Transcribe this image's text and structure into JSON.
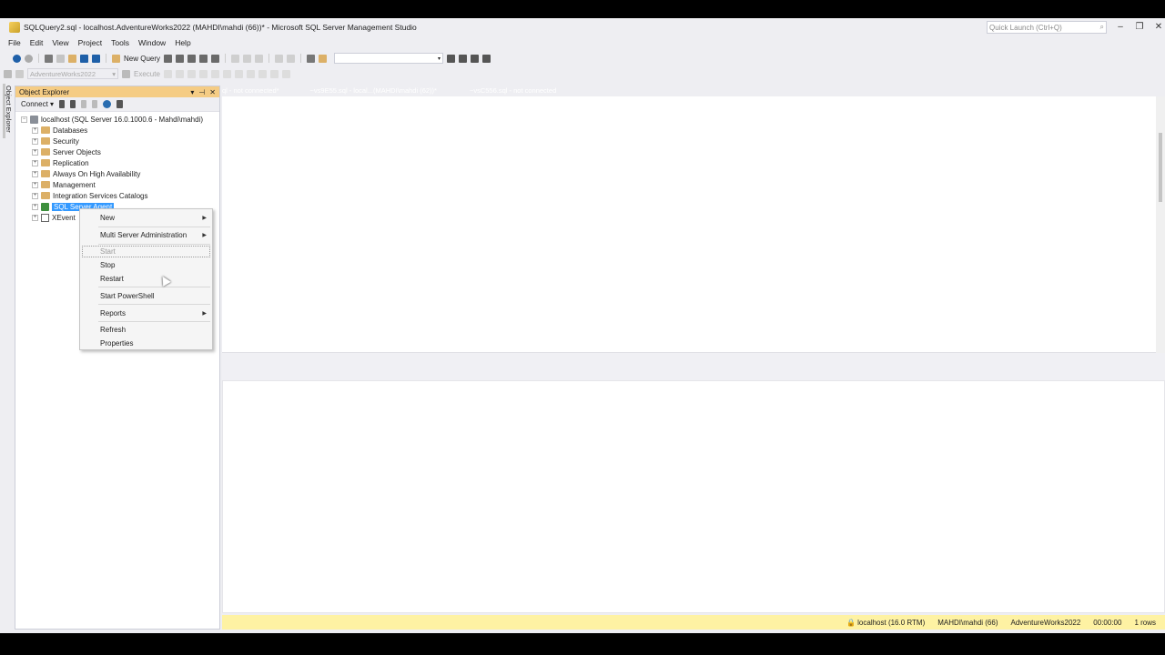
{
  "window": {
    "title": "SQLQuery2.sql - localhost.AdventureWorks2022 (MAHDI\\mahdi (66))* - Microsoft SQL Server Management Studio",
    "quick_launch_placeholder": "Quick Launch (Ctrl+Q)"
  },
  "menu": [
    "File",
    "Edit",
    "View",
    "Project",
    "Tools",
    "Window",
    "Help"
  ],
  "toolbar": {
    "new_query": "New Query",
    "database": "AdventureWorks2022",
    "execute": "Execute"
  },
  "sidebar_tab": "Object Explorer",
  "object_explorer": {
    "title": "Object Explorer",
    "connect": "Connect",
    "server": "localhost (SQL Server 16.0.1000.6 - Mahdi\\mahdi)",
    "nodes": [
      "Databases",
      "Security",
      "Server Objects",
      "Replication",
      "Always On High Availability",
      "Management",
      "Integration Services Catalogs",
      "SQL Server Agent",
      "XEvent"
    ]
  },
  "tabs": [
    "ql - not connected*",
    "~vs9E55.sql - local...(MAHDI\\mahdi (62))*",
    "~vsC556.sql - not connected"
  ],
  "context_menu": {
    "items": [
      "New",
      "Multi Server Administration",
      "Start",
      "Stop",
      "Restart",
      "Start PowerShell",
      "Reports",
      "Refresh",
      "Properties"
    ]
  },
  "status": {
    "server": "localhost (16.0 RTM)",
    "user": "MAHDI\\mahdi (66)",
    "database": "AdventureWorks2022",
    "time": "00:00:00",
    "rows": "1 rows"
  },
  "colors": {
    "accent": "#007acc",
    "oe_header": "#f5cc84",
    "status_bar": "#fef2a3",
    "selection": "#3399ff"
  }
}
